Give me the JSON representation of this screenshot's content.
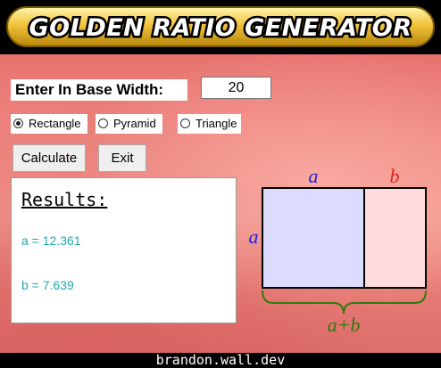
{
  "app": {
    "title": "GOLDEN RATIO GENERATOR"
  },
  "form": {
    "base_width_label": "Enter In Base Width:",
    "base_width_value": "20"
  },
  "shape_options": [
    {
      "label": "Rectangle",
      "selected": true
    },
    {
      "label": "Pyramid",
      "selected": false
    },
    {
      "label": "Triangle",
      "selected": false
    }
  ],
  "buttons": {
    "calculate": "Calculate",
    "exit": "Exit"
  },
  "results": {
    "title": "Results:",
    "a_line": "a = 12.361",
    "b_line": "b = 7.639"
  },
  "diagram": {
    "label_a_top": "a",
    "label_b_top": "b",
    "label_a_side": "a",
    "label_sum": "a+b",
    "colors": {
      "a_fill": "#dcdcff",
      "b_fill": "#ffdcdc",
      "a_label": "#2222dd",
      "b_label": "#dd2222",
      "brace": "#2f7a10"
    }
  },
  "footer": {
    "text": "brandon.wall.dev"
  }
}
